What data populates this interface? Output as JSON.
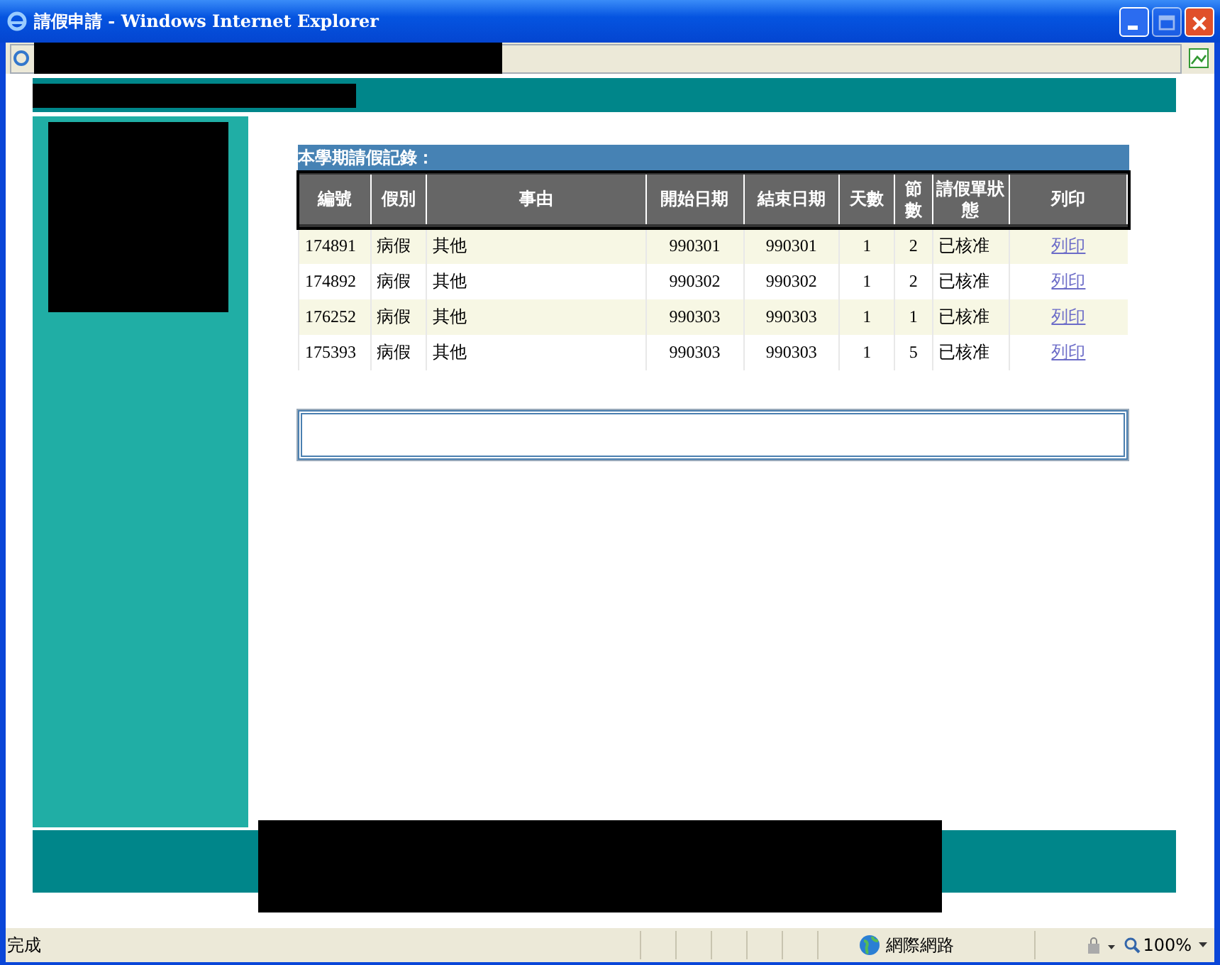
{
  "window": {
    "title": "請假申請 - Windows Internet Explorer"
  },
  "record": {
    "caption": "本學期請假記錄：",
    "columns": [
      "編號",
      "假別",
      "事由",
      "開始日期",
      "結束日期",
      "天數",
      "節數",
      "請假單狀態",
      "列印"
    ],
    "rows": [
      {
        "id": "174891",
        "type": "病假",
        "reason": "其他",
        "start": "990301",
        "end": "990301",
        "days": "1",
        "periods": "2",
        "status": "已核准",
        "print": "列印"
      },
      {
        "id": "174892",
        "type": "病假",
        "reason": "其他",
        "start": "990302",
        "end": "990302",
        "days": "1",
        "periods": "2",
        "status": "已核准",
        "print": "列印"
      },
      {
        "id": "176252",
        "type": "病假",
        "reason": "其他",
        "start": "990303",
        "end": "990303",
        "days": "1",
        "periods": "1",
        "status": "已核准",
        "print": "列印"
      },
      {
        "id": "175393",
        "type": "病假",
        "reason": "其他",
        "start": "990303",
        "end": "990303",
        "days": "1",
        "periods": "5",
        "status": "已核准",
        "print": "列印"
      }
    ]
  },
  "status_bar": {
    "status": "完成",
    "zone": "網際網路",
    "zoom": "100%"
  }
}
